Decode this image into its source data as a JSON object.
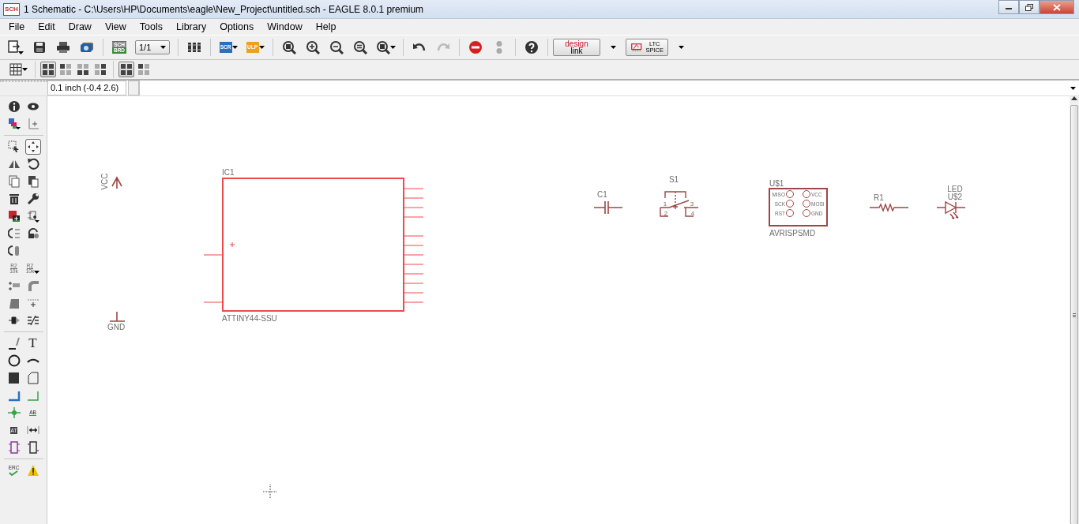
{
  "window": {
    "title": "1 Schematic - C:\\Users\\HP\\Documents\\eagle\\New_Project\\untitled.sch - EAGLE 8.0.1 premium",
    "icon_label": "SCH"
  },
  "menu": [
    {
      "label": "File"
    },
    {
      "label": "Edit"
    },
    {
      "label": "Draw"
    },
    {
      "label": "View"
    },
    {
      "label": "Tools"
    },
    {
      "label": "Library"
    },
    {
      "label": "Options"
    },
    {
      "label": "Window"
    },
    {
      "label": "Help"
    }
  ],
  "toolbar": {
    "sheet_icon": [
      "SCH",
      "BRD"
    ],
    "sheet_select": "1/1",
    "script_icon": "SCR",
    "ulp_icon": "ULP",
    "redo": {
      "disabled": true
    },
    "design_link": [
      "design",
      "link"
    ],
    "lt_spice": [
      "LTC",
      "SPICE"
    ]
  },
  "layout_buttons": [
    {
      "selected": true
    },
    {
      "selected": false
    },
    {
      "selected": false
    },
    {
      "selected": false
    }
  ],
  "panel_buttons": [
    {
      "selected": true
    },
    {
      "selected": false
    }
  ],
  "command_bar": {
    "grid_info": "0.1 inch (-0.4 2.6)"
  },
  "tool_palette": {
    "move_selected": true,
    "name_tool": [
      "R2",
      "10k"
    ],
    "value_tool": [
      "R2",
      "10k"
    ],
    "text_tool": "T",
    "label_tool": "AB",
    "attribute_tool": "AT",
    "erc_tool": "ERC"
  },
  "schematic": {
    "parts": [
      {
        "kind": "supply",
        "label": "VCC"
      },
      {
        "kind": "ground",
        "label": "GND"
      },
      {
        "kind": "ic",
        "name": "IC1",
        "value": "ATTINY44-SSU"
      },
      {
        "kind": "capacitor",
        "name": "C1"
      },
      {
        "kind": "switch",
        "name": "S1",
        "pins": [
          "1",
          "2",
          "3",
          "4"
        ]
      },
      {
        "kind": "header",
        "name": "U$1",
        "value": "AVRISPSMD",
        "pins": [
          "MISO",
          "SCK",
          "RST",
          "VCC",
          "MOSI",
          "GND"
        ]
      },
      {
        "kind": "resistor",
        "name": "R1"
      },
      {
        "kind": "led",
        "name": "U$2",
        "value": "LED"
      }
    ]
  }
}
